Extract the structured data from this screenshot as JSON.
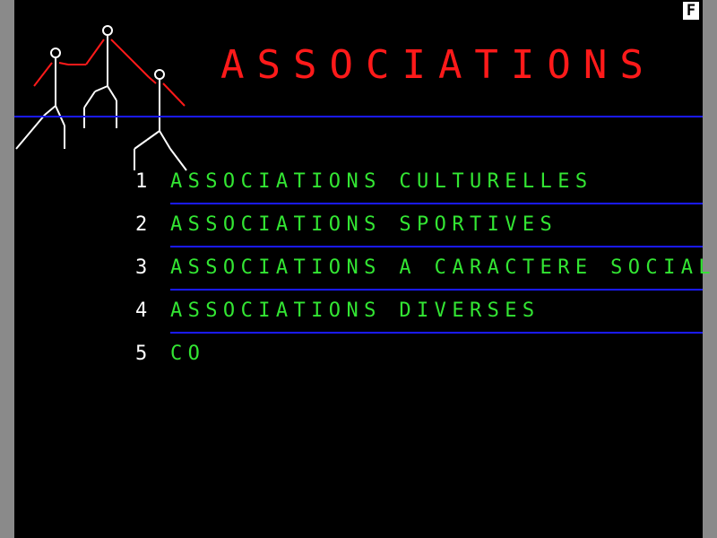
{
  "header": {
    "corner_badge": "F",
    "title": "ASSOCIATIONS"
  },
  "menu": {
    "items": [
      {
        "number": "1",
        "label": "ASSOCIATIONS CULTURELLES"
      },
      {
        "number": "2",
        "label": "ASSOCIATIONS SPORTIVES"
      },
      {
        "number": "3",
        "label": "ASSOCIATIONS A CARACTERE SOCIAL"
      },
      {
        "number": "4",
        "label": "ASSOCIATIONS DIVERSES"
      },
      {
        "number": "5",
        "label": "CO"
      }
    ]
  },
  "colors": {
    "background": "#000000",
    "title": "#ff1a1a",
    "menu_text": "#33e633",
    "numbers": "#ffffff",
    "rules": "#1a1aff"
  },
  "icons": [
    "stick-figures-icon"
  ]
}
